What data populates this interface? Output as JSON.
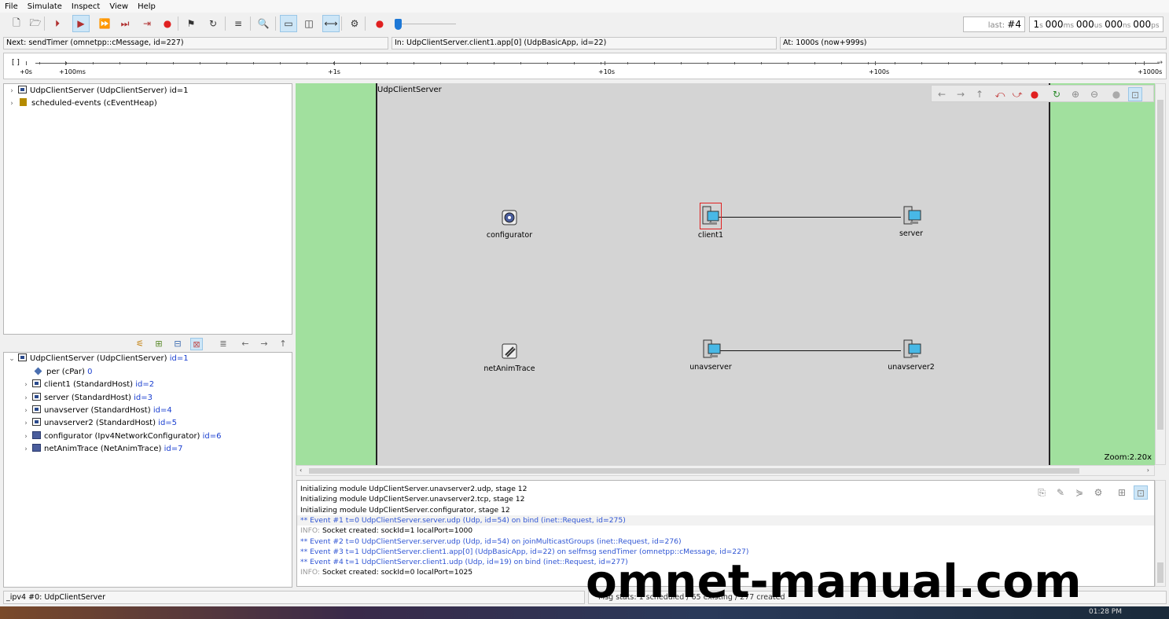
{
  "menu": [
    "File",
    "Simulate",
    "Inspect",
    "View",
    "Help"
  ],
  "toolbar": {
    "buttons": [
      {
        "name": "new-config-icon",
        "glyph": "🗋"
      },
      {
        "name": "open-icon",
        "glyph": "🗁"
      },
      {
        "name": "step-button",
        "glyph": "⏵",
        "label": "STEP"
      },
      {
        "name": "run-button",
        "glyph": "▶",
        "label": "RUN"
      },
      {
        "name": "fast-button",
        "glyph": "⏩",
        "label": "FAST"
      },
      {
        "name": "express-button",
        "glyph": "⏭",
        "label": "EXPRESS"
      },
      {
        "name": "until-button",
        "glyph": "⇥",
        "label": "UNTIL"
      },
      {
        "name": "stop-button",
        "glyph": "●",
        "label": "STOP"
      },
      {
        "name": "finish-icon",
        "glyph": "⚑"
      },
      {
        "name": "rebuild-icon",
        "glyph": "↻"
      },
      {
        "name": "rec-icon",
        "glyph": "≡",
        "label": "REC"
      },
      {
        "name": "find-icon",
        "glyph": "🔍"
      },
      {
        "name": "layout-horizontal-icon",
        "glyph": "▭"
      },
      {
        "name": "layout-vertical-icon",
        "glyph": "◫"
      },
      {
        "name": "timeline-icon",
        "glyph": "⟷"
      },
      {
        "name": "settings-icon",
        "glyph": "⚙"
      },
      {
        "name": "record-icon",
        "glyph": "●",
        "label": "REC"
      }
    ],
    "last_label": "last:",
    "last_value": "#4",
    "sim_time": {
      "s": "1",
      "ms": "000",
      "us": "000",
      "ns": "000",
      "ps": "000"
    }
  },
  "status": {
    "next": "Next: sendTimer (omnetpp::cMessage, id=227)",
    "in": "In: UdpClientServer.client1.app[0] (UdpBasicApp, id=22)",
    "at": "At: 1000s (now+999s)"
  },
  "timeline": {
    "bracket": "[   ]",
    "labels": [
      {
        "text": "+0s"
      },
      {
        "text": "+100ms"
      },
      {
        "text": "+1s"
      },
      {
        "text": "+10s"
      },
      {
        "text": "+100s"
      },
      {
        "text": "+1000s"
      }
    ]
  },
  "object_tree": [
    {
      "label": "UdpClientServer (UdpClientServer) id=1",
      "icon": "module"
    },
    {
      "label": "scheduled-events (cEventHeap)",
      "icon": "heap"
    }
  ],
  "inspector_tree": {
    "root": {
      "name": "UdpClientServer (UdpClientServer)",
      "id": "id=1"
    },
    "children": [
      {
        "name": "per (cPar)",
        "id": "0",
        "icon": "par",
        "expandable": false
      },
      {
        "name": "client1 (StandardHost)",
        "id": "id=2",
        "icon": "module",
        "expandable": true
      },
      {
        "name": "server (StandardHost)",
        "id": "id=3",
        "icon": "module",
        "expandable": true
      },
      {
        "name": "unavserver (StandardHost)",
        "id": "id=4",
        "icon": "module",
        "expandable": true
      },
      {
        "name": "unavserver2 (StandardHost)",
        "id": "id=5",
        "icon": "module",
        "expandable": true
      },
      {
        "name": "configurator (Ipv4NetworkConfigurator)",
        "id": "id=6",
        "icon": "solid",
        "expandable": true
      },
      {
        "name": "netAnimTrace (NetAnimTrace)",
        "id": "id=7",
        "icon": "solid",
        "expandable": true
      }
    ]
  },
  "network": {
    "name": "UdpClientServer",
    "zoom": "Zoom:2.20x",
    "nodes": [
      {
        "id": "configurator",
        "label": "configurator",
        "kind": "gear-icon"
      },
      {
        "id": "client1",
        "label": "client1",
        "kind": "host-icon",
        "selected": true
      },
      {
        "id": "server",
        "label": "server",
        "kind": "host-icon"
      },
      {
        "id": "netAnimTrace",
        "label": "netAnimTrace",
        "kind": "trace-icon"
      },
      {
        "id": "unavserver",
        "label": "unavserver",
        "kind": "host-icon"
      },
      {
        "id": "unavserver2",
        "label": "unavserver2",
        "kind": "host-icon"
      }
    ],
    "links": [
      [
        "client1",
        "server"
      ],
      [
        "unavserver",
        "unavserver2"
      ]
    ]
  },
  "log": [
    {
      "text": "Initializing module UdpClientServer.unavserver2.udp, stage 12",
      "kind": "plain"
    },
    {
      "text": "Initializing module UdpClientServer.unavserver2.tcp, stage 12",
      "kind": "plain"
    },
    {
      "text": "Initializing module UdpClientServer.configurator, stage 12",
      "kind": "plain"
    },
    {
      "text": "** Event #1  t=0  UdpClientServer.server.udp (Udp, id=54)  on bind (inet::Request, id=275)",
      "kind": "event",
      "highlight": true
    },
    {
      "prefix": "INFO:",
      "text": " Socket created: sockId=1 localPort=1000",
      "kind": "info"
    },
    {
      "text": "** Event #2  t=0  UdpClientServer.server.udp (Udp, id=54)  on joinMulticastGroups (inet::Request, id=276)",
      "kind": "event"
    },
    {
      "text": "** Event #3  t=1  UdpClientServer.client1.app[0] (UdpBasicApp, id=22)  on selfmsg sendTimer (omnetpp::cMessage, id=227)",
      "kind": "event"
    },
    {
      "text": "** Event #4  t=1  UdpClientServer.client1.udp (Udp, id=19)  on bind (inet::Request, id=277)",
      "kind": "event"
    },
    {
      "prefix": "INFO:",
      "text": " Socket created: sockId=0 localPort=1025",
      "kind": "info"
    }
  ],
  "bottom_status": {
    "left": "_ipv4 #0: UdpClientServer",
    "right": "Msg stats: 1 scheduled / 65 existing / 277 created"
  },
  "taskbar_clock": "01:28 PM",
  "watermark": "omnet-manual.com"
}
